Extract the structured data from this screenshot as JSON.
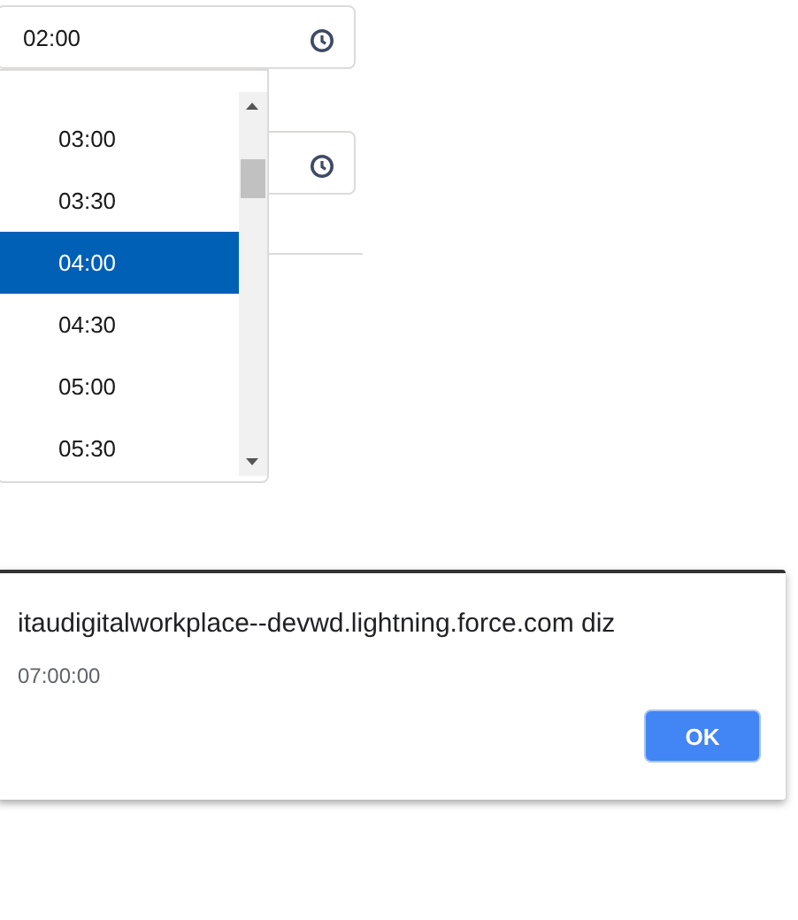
{
  "time_field": {
    "value": "02:00"
  },
  "dropdown": {
    "options": [
      {
        "label": "03:00",
        "selected": false
      },
      {
        "label": "03:30",
        "selected": false
      },
      {
        "label": "04:00",
        "selected": true
      },
      {
        "label": "04:30",
        "selected": false
      },
      {
        "label": "05:00",
        "selected": false
      },
      {
        "label": "05:30",
        "selected": false
      }
    ]
  },
  "dialog": {
    "title": "itaudigitalworkplace--devwd.lightning.force.com diz",
    "message": "07:00:00",
    "button": "OK"
  }
}
